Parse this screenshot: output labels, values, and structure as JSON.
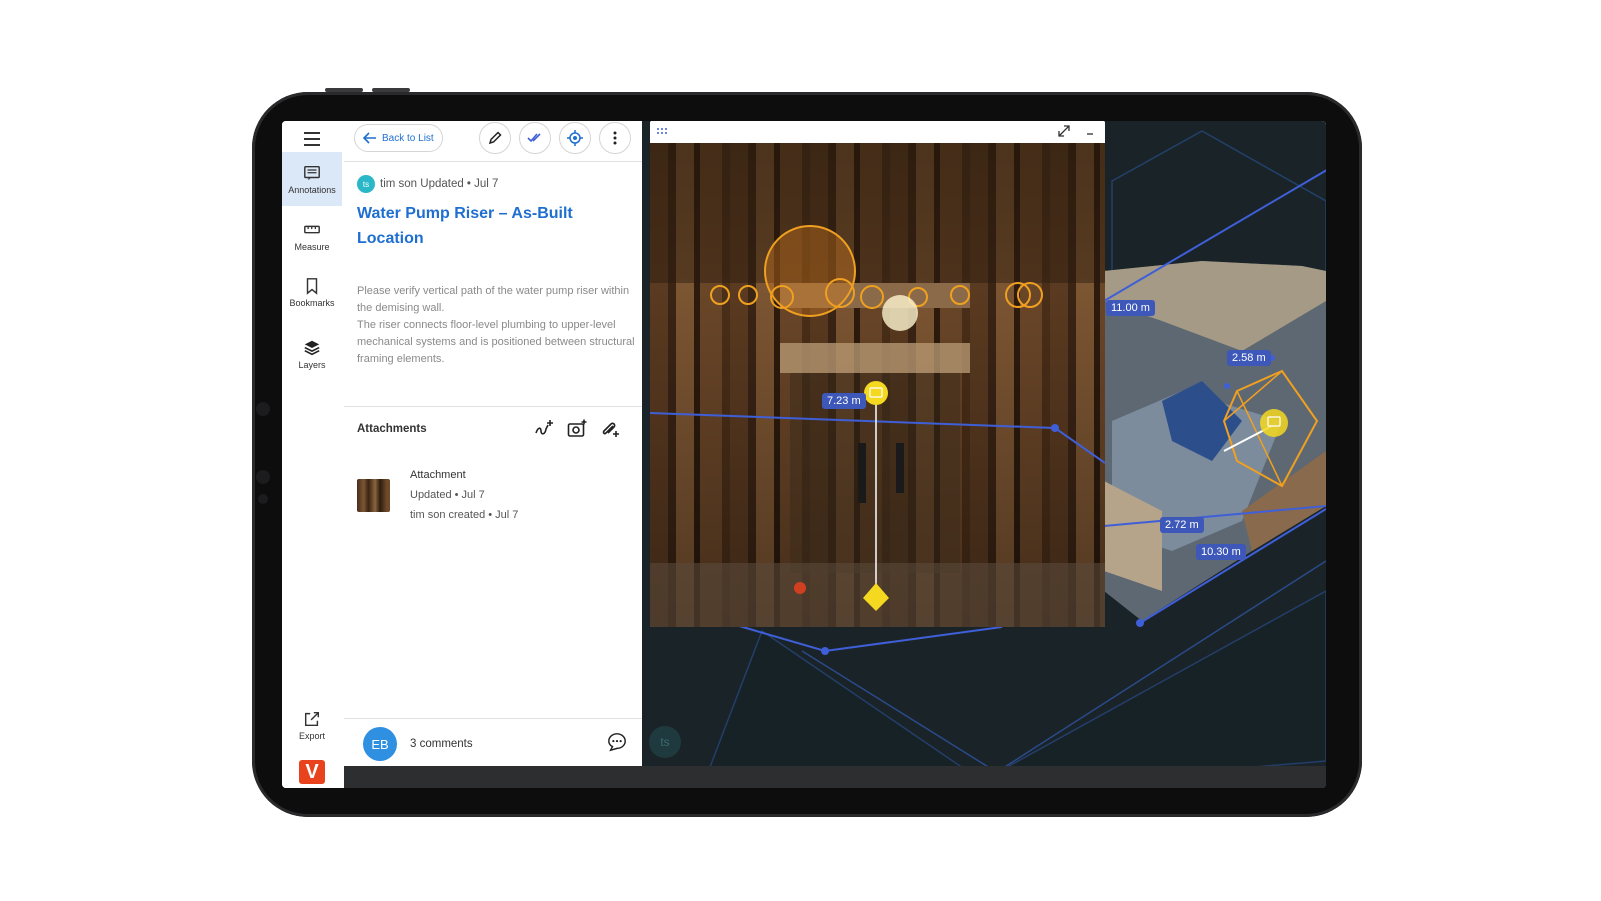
{
  "rail": {
    "items": [
      {
        "label": "Annotations",
        "icon": "annotations-icon",
        "active": true
      },
      {
        "label": "Measure",
        "icon": "ruler-icon",
        "active": false
      },
      {
        "label": "Bookmarks",
        "icon": "bookmark-icon",
        "active": false
      },
      {
        "label": "Layers",
        "icon": "layers-icon",
        "active": false
      }
    ],
    "export_label": "Export",
    "logo_text": "V"
  },
  "panel": {
    "back_label": "Back to List",
    "author_initials": "ts",
    "author_line": "tim son Updated • Jul 7",
    "title": "Water Pump Riser – As-Built Location",
    "description_1": "Please verify vertical path of the water pump riser within the demising wall.",
    "description_2": "The riser connects floor-level plumbing to upper-level mechanical systems and is positioned between structural framing elements.",
    "attachments_label": "Attachments",
    "attachment": {
      "name": "Attachment",
      "updated": "Updated • Jul 7",
      "created": "tim son created • Jul 7"
    },
    "footer": {
      "avatar_initials": "EB",
      "comments_label": "3 comments"
    }
  },
  "viewport": {
    "measurements": [
      "7.23 m",
      "11.00 m",
      "2.58 m",
      "2.72 m",
      "10.30 m"
    ],
    "user_bubble": "ts",
    "accent_line": "#3f5fd8",
    "marker_color": "#f5d820"
  },
  "colors": {
    "accent": "#1f6fd1",
    "active_bg": "#dbe8f7",
    "logo": "#e8431c"
  }
}
